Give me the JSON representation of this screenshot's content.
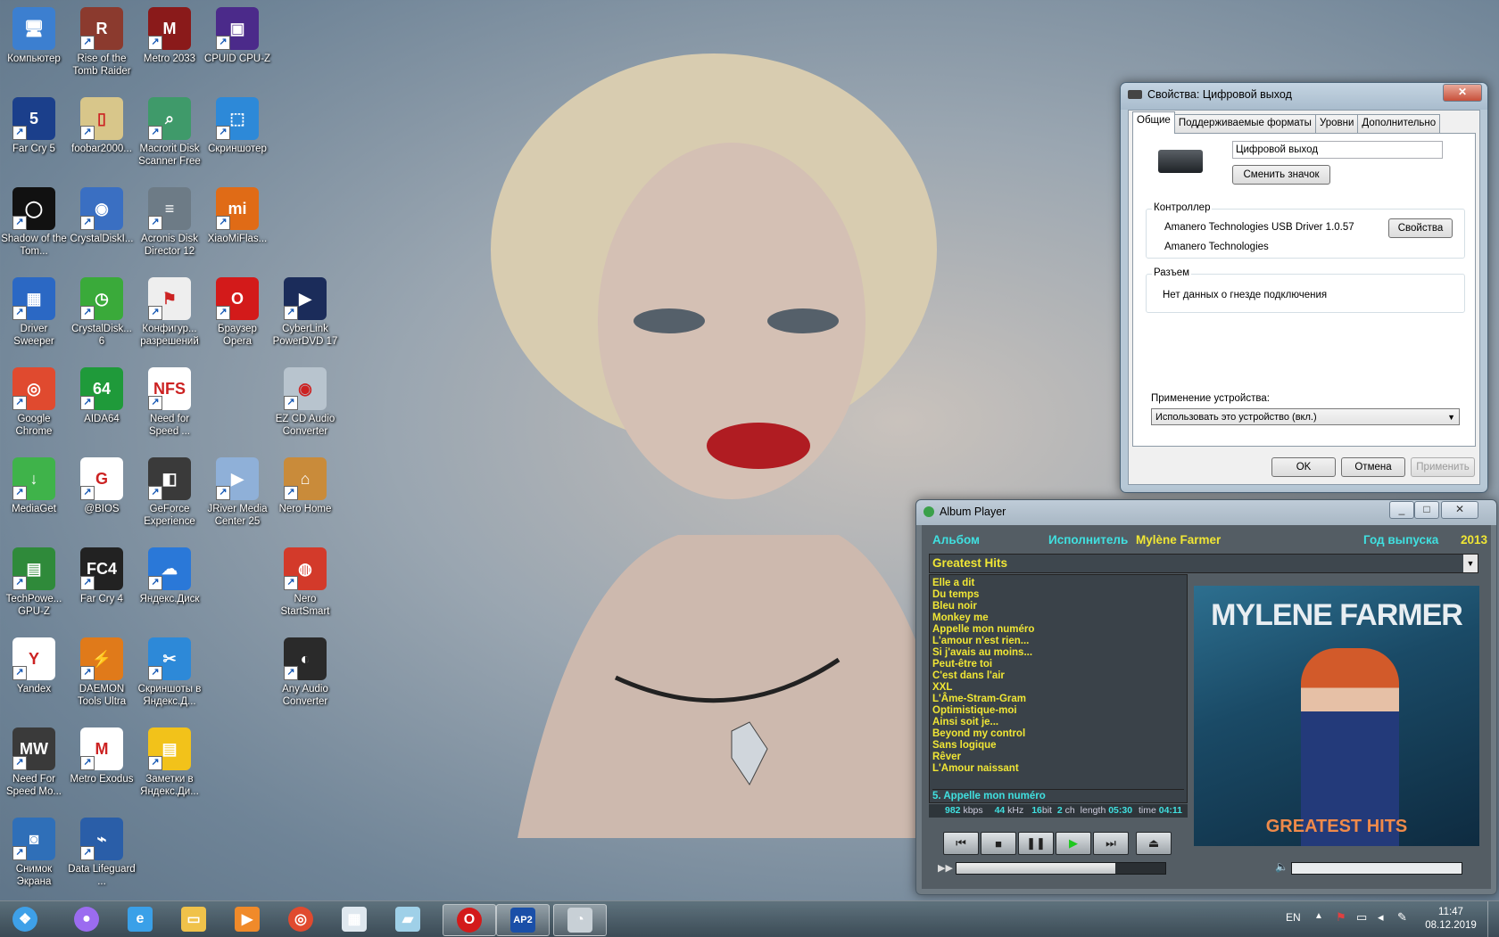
{
  "desktop": {
    "icons": [
      {
        "label": "Компьютер",
        "color": "#3c7fd0",
        "glyph": "🖥",
        "icon": "computer-icon"
      },
      {
        "label": "Rise of the Tomb Raider",
        "color": "#8b3a2e",
        "glyph": "R",
        "icon": "tomb-raider-icon"
      },
      {
        "label": "Metro 2033",
        "color": "#8a1a1a",
        "glyph": "M",
        "icon": "metro-2033-icon"
      },
      {
        "label": "CPUID CPU-Z",
        "color": "#4b2a8a",
        "glyph": "▣",
        "icon": "cpu-z-icon"
      },
      {
        "label": "Far Cry 5",
        "color": "#1b3f8b",
        "glyph": "5",
        "icon": "far-cry-5-icon"
      },
      {
        "label": "foobar2000...",
        "color": "#d8c68a",
        "glyph": "▯",
        "icon": "foobar-icon"
      },
      {
        "label": "Macrorit Disk Scanner Free",
        "color": "#3f9a6a",
        "glyph": "⌕",
        "icon": "disk-scanner-icon"
      },
      {
        "label": "Скриншотер",
        "color": "#2d89d8",
        "glyph": "⬚",
        "icon": "screenshot-tool-icon"
      },
      {
        "label": "Shadow of the Tom...",
        "color": "#111111",
        "glyph": "◯",
        "icon": "shadow-tomb-raider-icon"
      },
      {
        "label": "CrystalDiskI...",
        "color": "#3a6fc2",
        "glyph": "◉",
        "icon": "crystaldiskinfo-icon"
      },
      {
        "label": "Acronis Disk Director 12",
        "color": "#6d7b86",
        "glyph": "≡",
        "icon": "acronis-icon"
      },
      {
        "label": "XiaoMiFlas...",
        "color": "#e06b16",
        "glyph": "mi",
        "icon": "xiaomi-flash-icon"
      },
      {
        "label": "Driver Sweeper",
        "color": "#2b68c4",
        "glyph": "▦",
        "icon": "driver-sweeper-icon"
      },
      {
        "label": "CrystalDisk... 6",
        "color": "#3aaa3a",
        "glyph": "◷",
        "icon": "crystaldiskmark-icon"
      },
      {
        "label": "Конфигур... разрешений",
        "color": "#eeeeee",
        "glyph": "⚑",
        "icon": "permissions-config-icon"
      },
      {
        "label": "Браузер Opera",
        "color": "#d31a1a",
        "glyph": "O",
        "icon": "opera-browser-icon"
      },
      {
        "label": "CyberLink PowerDVD 17",
        "color": "#1b2c5a",
        "glyph": "▶",
        "icon": "powerdvd-icon"
      },
      {
        "label": "Google Chrome",
        "color": "#e04a2f",
        "glyph": "◎",
        "icon": "chrome-icon"
      },
      {
        "label": "AIDA64",
        "color": "#1f9a3a",
        "glyph": "64",
        "icon": "aida64-icon"
      },
      {
        "label": "Need for Speed ...",
        "color": "#ffffff",
        "glyph": "NFS",
        "icon": "nfs-icon"
      },
      {
        "label": "EZ CD Audio Converter",
        "color": "#b8c4ce",
        "glyph": "◉",
        "icon": "ez-cd-icon"
      },
      {
        "label": "MediaGet",
        "color": "#3fb34a",
        "glyph": "↓",
        "icon": "mediaget-icon"
      },
      {
        "label": "@BIOS",
        "color": "#ffffff",
        "glyph": "G",
        "icon": "bios-icon"
      },
      {
        "label": "GeForce Experience",
        "color": "#3a3a3a",
        "glyph": "◧",
        "icon": "geforce-icon"
      },
      {
        "label": "JRiver Media Center 25",
        "color": "#8fb0d8",
        "glyph": "▶",
        "icon": "jriver-icon"
      },
      {
        "label": "Nero Home",
        "color": "#c98b3a",
        "glyph": "⌂",
        "icon": "nero-home-icon"
      },
      {
        "label": "TechPowe... GPU-Z",
        "color": "#2f8a3a",
        "glyph": "▤",
        "icon": "gpu-z-icon"
      },
      {
        "label": "Far Cry 4",
        "color": "#222222",
        "glyph": "FC4",
        "icon": "far-cry-4-icon"
      },
      {
        "label": "Яндекс.Диск",
        "color": "#2a78d8",
        "glyph": "☁",
        "icon": "yandex-disk-icon"
      },
      {
        "label": "Nero StartSmart",
        "color": "#d33a2a",
        "glyph": "◍",
        "icon": "nero-startsmart-icon"
      },
      {
        "label": "Yandex",
        "color": "#ffffff",
        "glyph": "Y",
        "icon": "yandex-browser-icon"
      },
      {
        "label": "DAEMON Tools Ultra",
        "color": "#e07a1a",
        "glyph": "⚡",
        "icon": "daemon-tools-icon"
      },
      {
        "label": "Скриншоты в Яндекс.Д...",
        "color": "#2d89d8",
        "glyph": "✂",
        "icon": "yandex-screenshots-icon"
      },
      {
        "label": "Any Audio Converter",
        "color": "#2a2a2a",
        "glyph": "◐",
        "icon": "any-audio-icon"
      },
      {
        "label": "Need For Speed Mo...",
        "color": "#3a3a3a",
        "glyph": "MW",
        "icon": "nfs-mw-icon"
      },
      {
        "label": "Metro Exodus",
        "color": "#ffffff",
        "glyph": "M",
        "icon": "metro-exodus-icon"
      },
      {
        "label": "Заметки в Яндекс.Ди...",
        "color": "#f2c21a",
        "glyph": "▤",
        "icon": "yandex-notes-icon"
      },
      {
        "label": "Снимок Экрана",
        "color": "#2f6fb8",
        "glyph": "◙",
        "icon": "camera-icon"
      },
      {
        "label": "Data Lifeguard ...",
        "color": "#2a5ea8",
        "glyph": "⌁",
        "icon": "data-lifeguard-icon"
      }
    ]
  },
  "props": {
    "title": "Свойства: Цифровой выход",
    "tabs": [
      "Общие",
      "Поддерживаемые форматы",
      "Уровни",
      "Дополнительно"
    ],
    "name_value": "Цифровой выход",
    "change_icon": "Сменить значок",
    "controller_label": "Контроллер",
    "controller_name": "Amanero Technologies USB Driver 1.0.57",
    "controller_vendor": "Amanero Technologies",
    "controller_props": "Свойства",
    "jack_label": "Разъем",
    "jack_info": "Нет данных о гнезде подключения",
    "usage_label": "Применение устройства:",
    "usage_value": "Использовать это устройство (вкл.)",
    "ok": "OK",
    "cancel": "Отмена",
    "apply": "Применить"
  },
  "player": {
    "title": "Album Player",
    "album_label": "Альбом",
    "artist_label": "Исполнитель",
    "artist": "Mylène Farmer",
    "year_label": "Год выпуска",
    "year": "2013",
    "album": "Greatest Hits",
    "tracks": [
      "Elle a dit",
      "Du temps",
      "Bleu noir",
      "Monkey me",
      "Appelle mon numéro",
      "L'amour n'est rien...",
      "Si j'avais au moins...",
      "Peut-être toi",
      "C'est dans l'air",
      "XXL",
      "L'Âme-Stram-Gram",
      "Optimistique-moi",
      "Ainsi soit je...",
      "Beyond my control",
      "Sans logique",
      "Rêver",
      "L'Amour naissant"
    ],
    "now_playing": "5.  Appelle mon numéro",
    "bitrate": "982",
    "bitrate_unit": "kbps",
    "samplerate": "44",
    "samplerate_unit": "kHz",
    "bits": "16",
    "bits_unit": "bit",
    "channels": "2",
    "channels_unit": "ch",
    "length_label": "length",
    "length": "05:30",
    "time_label": "time",
    "time": "04:11",
    "cover_artist": "MYLENE FARMER",
    "cover_title": "GREATEST HITS",
    "seek_progress": 0.76,
    "volume": 0.0
  },
  "taskbar": {
    "items": [
      {
        "icon": "start-orb-icon",
        "glyph": "❖",
        "color": "#3ea0e8"
      },
      {
        "icon": "alice-assistant-icon",
        "glyph": "●",
        "color": "#9b6cf0"
      },
      {
        "icon": "internet-explorer-icon",
        "glyph": "e",
        "color": "#3aa0e8"
      },
      {
        "icon": "file-explorer-icon",
        "glyph": "▭",
        "color": "#f0c24a"
      },
      {
        "icon": "media-player-icon",
        "glyph": "▶",
        "color": "#f08a2a"
      },
      {
        "icon": "chrome-taskbar-icon",
        "glyph": "◎",
        "color": "#e04a2f"
      },
      {
        "icon": "calculator-icon",
        "glyph": "▦",
        "color": "#dfe8ef"
      },
      {
        "icon": "notepad-icon",
        "glyph": "▰",
        "color": "#9fd0e8"
      },
      {
        "icon": "opera-taskbar-icon",
        "glyph": "O",
        "color": "#d31a1a"
      },
      {
        "icon": "album-player-taskbar-icon",
        "glyph": "AP2",
        "color": "#1a4fa8"
      },
      {
        "icon": "speaker-taskbar-icon",
        "glyph": "◔",
        "color": "#c8d0d6"
      }
    ],
    "lang": "EN",
    "time": "11:47",
    "date": "08.12.2019"
  }
}
